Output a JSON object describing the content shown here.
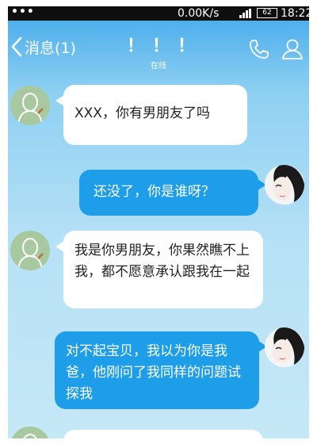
{
  "status_bar": {
    "dots": "•••",
    "network_speed": "0.00K/s",
    "battery_level": "62",
    "time": "18:22"
  },
  "header": {
    "back_label": "消息(1)",
    "contact_name": "！！！",
    "contact_status": "在线"
  },
  "messages": [
    {
      "sender": "friend",
      "text": "XXX，你有男朋友了吗"
    },
    {
      "sender": "me",
      "text": "还没了，你是谁呀？"
    },
    {
      "sender": "friend",
      "text": "我是你男朋友，你果然瞧不上我，都不愿意承认跟我在一起"
    },
    {
      "sender": "me",
      "text": "对不起宝贝，我以为你是我爸，他刚问了我同样的问题试探我"
    },
    {
      "sender": "friend",
      "text": ""
    }
  ],
  "colors": {
    "header_blue": "#43a9ea",
    "outgoing_bubble": "#1e9ee9",
    "incoming_bubble": "#ffffff",
    "status_bar": "#0f0f10"
  }
}
